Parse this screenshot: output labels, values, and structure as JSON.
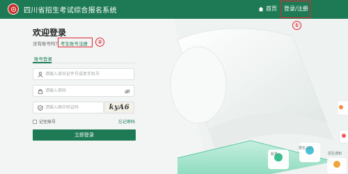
{
  "header": {
    "site_title": "四川省招生考试综合报名系统",
    "home_label": "首页",
    "login_register_label": "登录/注册"
  },
  "annotations": {
    "marker_1": "①",
    "marker_2": "②"
  },
  "login": {
    "welcome": "欢迎登录",
    "no_account_text": "没有账号吗？",
    "register_link": "考生账号注册",
    "tab_account": "账号登录",
    "id_placeholder": "请输入身份证件号或者手机号",
    "password_placeholder": "请输入密码",
    "captcha_placeholder": "请输入图中验证码",
    "captcha_text": "kyA6",
    "remember_label": "记住账号",
    "forgot_label": "忘记密码",
    "submit_label": "立即登录"
  },
  "illustration": {
    "tile_1": "报名入口",
    "tile_2": "招生通知",
    "tile_3": "账号"
  },
  "colors": {
    "brand_green": "#1e7a55",
    "annotation_red": "#e0242f",
    "logo_red": "#c9302c"
  },
  "icons": [
    "logo-icon",
    "home-icon",
    "user-icon",
    "lock-icon",
    "eye-off-icon",
    "shield-icon"
  ]
}
